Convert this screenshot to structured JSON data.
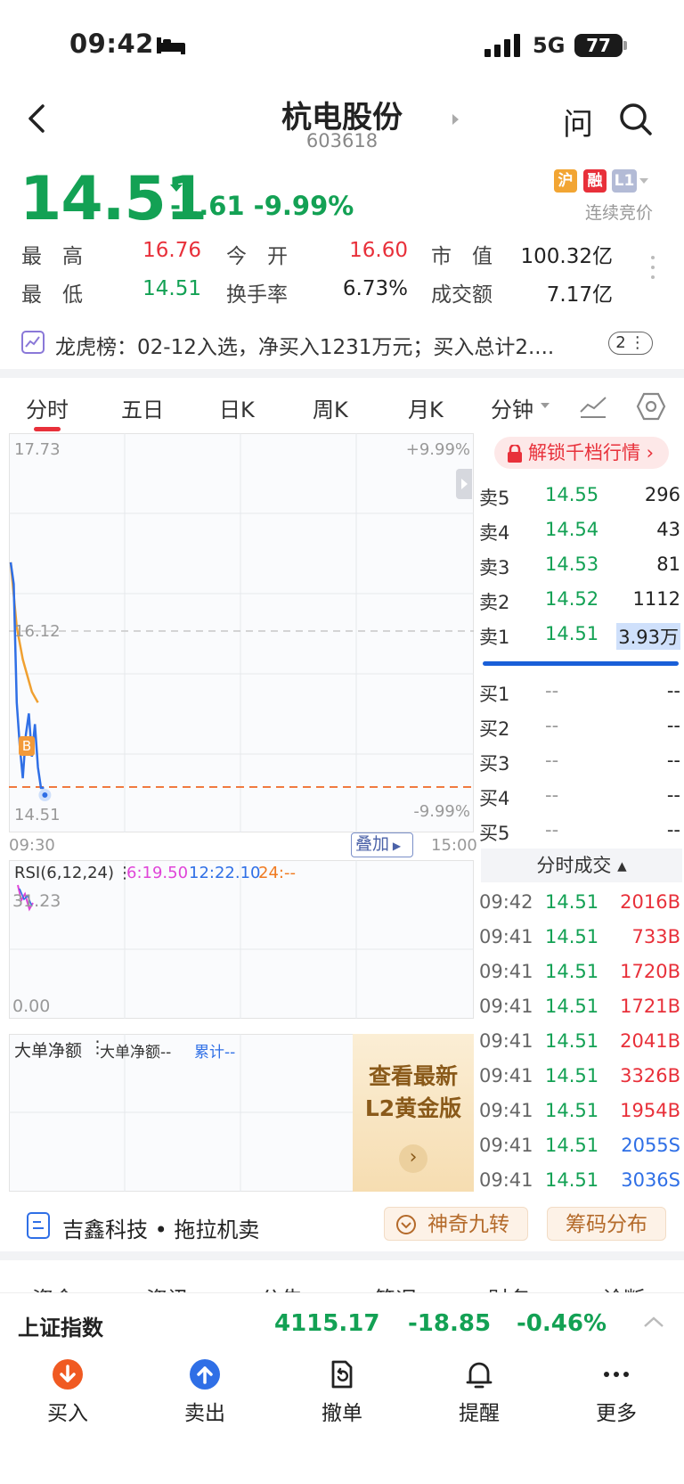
{
  "status_bar": {
    "time": "09:42",
    "network": "5G",
    "battery": "77"
  },
  "header": {
    "name": "杭电股份",
    "code": "603618",
    "ask": "问"
  },
  "quote": {
    "price": "14.51",
    "change": "-1.61 -9.99%",
    "tags": [
      "沪",
      "融",
      "L1"
    ],
    "trade_mode": "连续竞价",
    "stats": [
      {
        "label": "最　高",
        "value": "16.76",
        "color": "red"
      },
      {
        "label": "今　开",
        "value": "16.60",
        "color": "red"
      },
      {
        "label": "市　值",
        "value": "100.32亿",
        "color": "black"
      },
      {
        "label": "最　低",
        "value": "14.51",
        "color": "green"
      },
      {
        "label": "换手率",
        "value": "6.73%",
        "color": "black"
      },
      {
        "label": "成交额",
        "value": "7.17亿",
        "color": "black"
      }
    ]
  },
  "dragon_tiger": {
    "text": "龙虎榜：02-12入选，净买入1231万元；买入总计2....",
    "count": "2"
  },
  "chart_tabs": [
    "分时",
    "五日",
    "日K",
    "周K",
    "月K",
    "分钟"
  ],
  "chart": {
    "price_high": "17.73",
    "pct_high": "+9.99%",
    "price_mid": "16.12",
    "price_low": "14.51",
    "pct_low": "-9.99%",
    "time_start": "09:30",
    "time_end": "15:00",
    "overlay_button": "叠加",
    "buy_marker": "B",
    "price_series": [
      16.6,
      16.4,
      15.3,
      14.9,
      14.6,
      15.0,
      15.2,
      14.8,
      15.1,
      14.7,
      14.51,
      14.51
    ],
    "avg_series": [
      16.6,
      16.3,
      16.0,
      15.85,
      15.7,
      15.6,
      15.5,
      15.4,
      15.35,
      15.3
    ]
  },
  "rsi": {
    "title": "RSI(6,12,24)",
    "r6": "6:19.50",
    "r12": "12:22.10",
    "r24": "24:--",
    "top": "31.23",
    "bottom": "0.00"
  },
  "flow": {
    "title": "大单净额",
    "sub": "大单净额--",
    "cum": "累计--"
  },
  "promo": {
    "line1": "查看最新",
    "line2": "L2黄金版",
    "arrow": "›"
  },
  "order_book": {
    "unlock": "解锁千档行情 ›",
    "asks": [
      {
        "label": "卖5",
        "price": "14.55",
        "vol": "296"
      },
      {
        "label": "卖4",
        "price": "14.54",
        "vol": "43"
      },
      {
        "label": "卖3",
        "price": "14.53",
        "vol": "81"
      },
      {
        "label": "卖2",
        "price": "14.52",
        "vol": "1112"
      },
      {
        "label": "卖1",
        "price": "14.51",
        "vol": "3.93万"
      }
    ],
    "bids": [
      {
        "label": "买1",
        "price": "--",
        "vol": "--"
      },
      {
        "label": "买2",
        "price": "--",
        "vol": "--"
      },
      {
        "label": "买3",
        "price": "--",
        "vol": "--"
      },
      {
        "label": "买4",
        "price": "--",
        "vol": "--"
      },
      {
        "label": "买5",
        "price": "--",
        "vol": "--"
      }
    ]
  },
  "trades": {
    "header": "分时成交 ▴",
    "rows": [
      {
        "time": "09:42",
        "price": "14.51",
        "vol": "2016B",
        "side": "B"
      },
      {
        "time": "09:41",
        "price": "14.51",
        "vol": "733B",
        "side": "B"
      },
      {
        "time": "09:41",
        "price": "14.51",
        "vol": "1720B",
        "side": "B"
      },
      {
        "time": "09:41",
        "price": "14.51",
        "vol": "1721B",
        "side": "B"
      },
      {
        "time": "09:41",
        "price": "14.51",
        "vol": "2041B",
        "side": "B"
      },
      {
        "time": "09:41",
        "price": "14.51",
        "vol": "3326B",
        "side": "B"
      },
      {
        "time": "09:41",
        "price": "14.51",
        "vol": "1954B",
        "side": "B"
      },
      {
        "time": "09:41",
        "price": "14.51",
        "vol": "2055S",
        "side": "S"
      },
      {
        "time": "09:41",
        "price": "14.51",
        "vol": "3036S",
        "side": "S"
      }
    ]
  },
  "bottom_info": {
    "text": "吉鑫科技 • 拖拉机卖",
    "nine": "神奇九转",
    "chip": "筹码分布"
  },
  "tabs_peek": [
    "资金",
    "资讯",
    "公告",
    "简况",
    "财务",
    "诊断"
  ],
  "index": {
    "name": "上证指数",
    "value": "4115.17",
    "change": "-18.85",
    "pct": "-0.46%"
  },
  "actions": [
    "买入",
    "卖出",
    "撤单",
    "提醒",
    "更多"
  ]
}
